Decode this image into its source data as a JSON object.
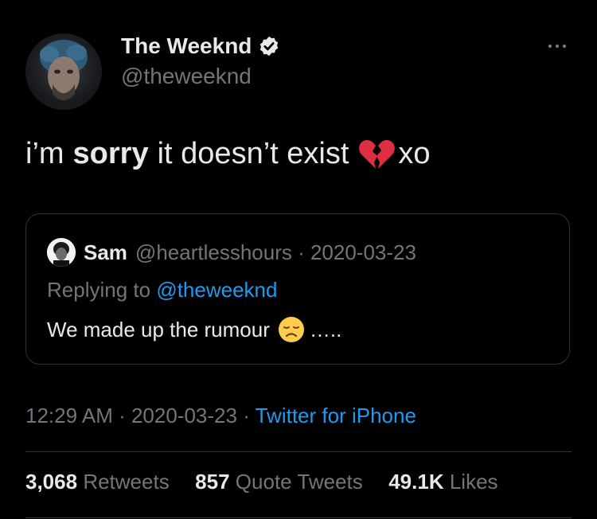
{
  "author": {
    "display_name": "The Weeknd",
    "handle": "@theweeknd",
    "avatar_icon": "profile-photo",
    "verified_icon": "verified-badge-icon"
  },
  "tweet": {
    "text_before": "i’m",
    "text_bold": "sorry",
    "text_middle": "it doesn’t exist",
    "emoji": "broken-heart-emoji",
    "text_after": "xo"
  },
  "quote": {
    "name": "Sam",
    "handle": "@heartlesshours",
    "separator": " · ",
    "date": "2020-03-23",
    "replying_prefix": "Replying to",
    "replying_to": "@theweeknd",
    "body_text": "We made up the rumour",
    "body_emoji": "disappointed-face-emoji",
    "body_suffix": "…..",
    "avatar_icon": "quoted-user-avatar"
  },
  "meta": {
    "time": "12:29 AM",
    "sep1": " · ",
    "date": "2020-03-23",
    "sep2": " · ",
    "source": "Twitter for iPhone"
  },
  "stats": {
    "retweets_count": "3,068",
    "retweets_label": "Retweets",
    "quotes_count": "857",
    "quotes_label": "Quote Tweets",
    "likes_count": "49.1K",
    "likes_label": "Likes"
  },
  "colors": {
    "background": "#000000",
    "primary_text": "#e7e9ea",
    "secondary_text": "#71767b",
    "link": "#1d9bf0",
    "border": "#2f3336"
  }
}
